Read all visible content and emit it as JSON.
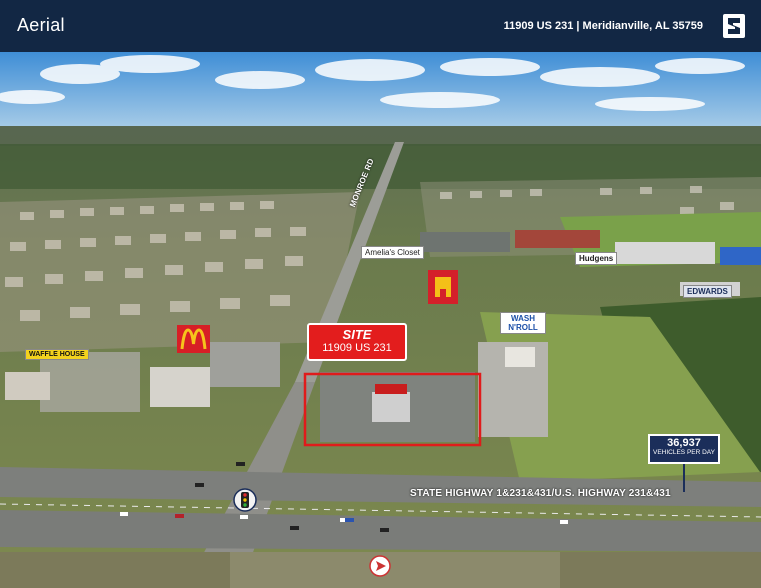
{
  "header": {
    "title": "Aerial",
    "address": "11909 US 231 | Meridianville, AL 35759"
  },
  "site": {
    "title": "SITE",
    "address": "11909 US 231"
  },
  "traffic": {
    "count": "36,937",
    "unit": "VEHICLES PER DAY"
  },
  "roads": {
    "highway": "STATE HIGHWAY 1&231&431/U.S. HIGHWAY 231&431",
    "monroe": "MONROE RD"
  },
  "businesses": {
    "amelias": "Amelia's Closet",
    "hudgens": "Hudgens",
    "edwards": "EDWARDS",
    "wash_n_roll": "WASH N'ROLL",
    "waffle_house": "WAFFLE HOUSE"
  },
  "colors": {
    "header_bg": "#122744",
    "site_red": "#e31d1d",
    "traffic_navy": "#1b2e5a"
  }
}
